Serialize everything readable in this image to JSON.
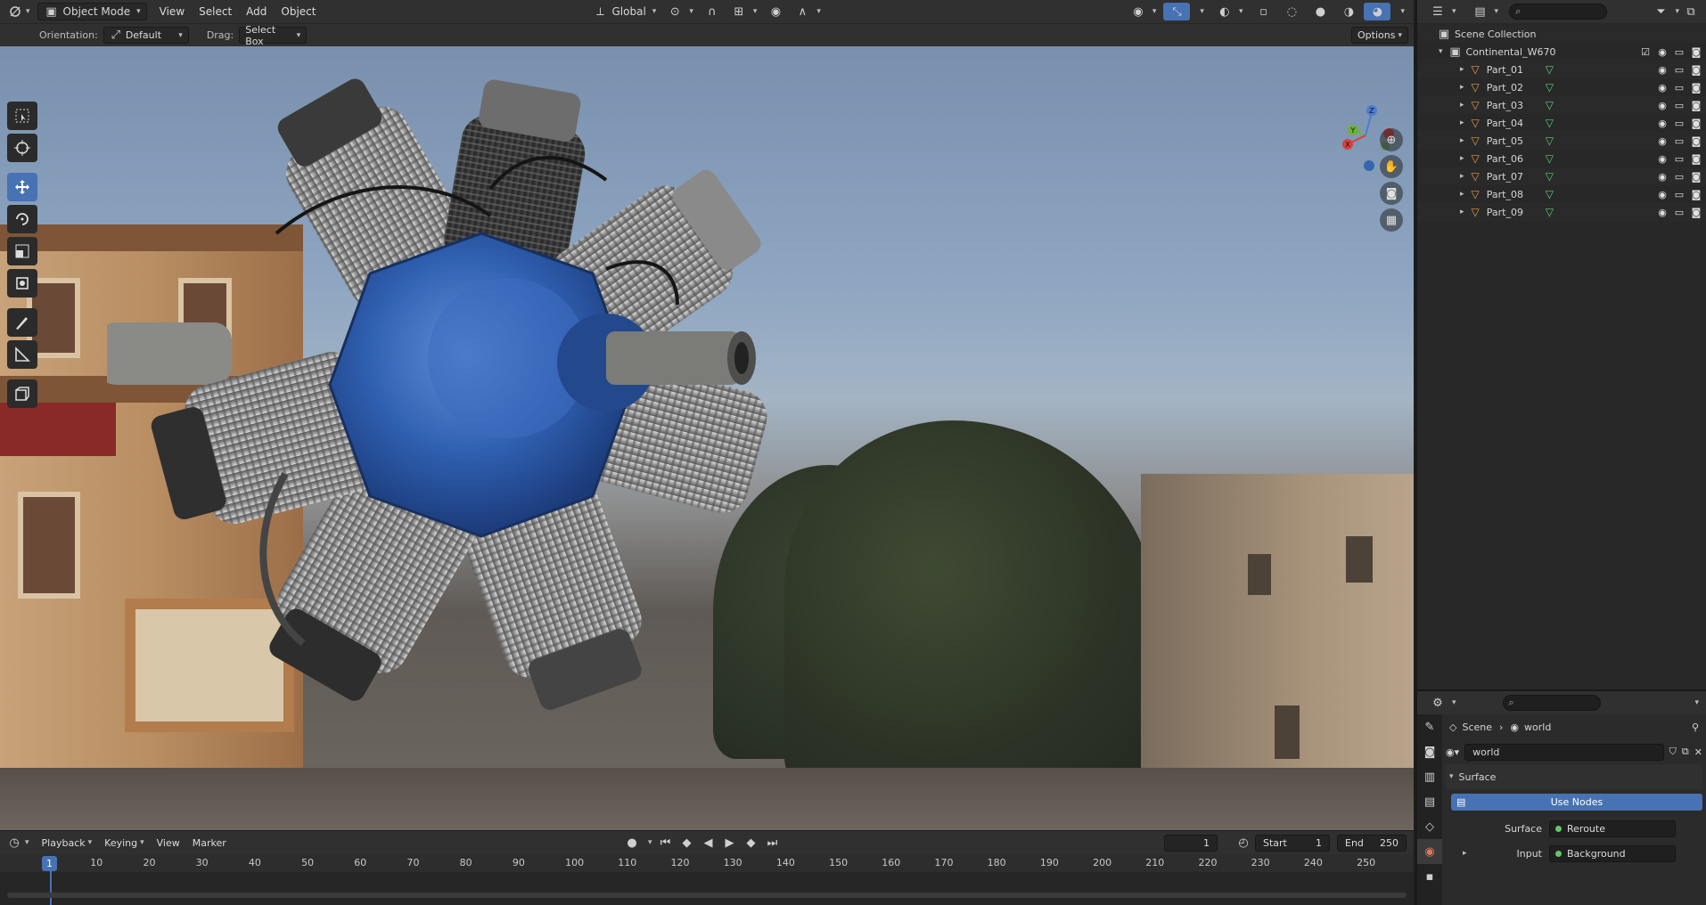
{
  "header": {
    "mode": "Object Mode",
    "menus": [
      "View",
      "Select",
      "Add",
      "Object"
    ],
    "transform_orientation": "Global"
  },
  "tool_header": {
    "orientation_label": "Orientation:",
    "orientation_value": "Default",
    "drag_label": "Drag:",
    "drag_value": "Select Box",
    "options": "Options"
  },
  "gizmo": {
    "x": "X",
    "y": "Y",
    "z": "Z"
  },
  "outliner": {
    "root": "Scene Collection",
    "collection": "Continental_W670",
    "items": [
      {
        "name": "Part_01"
      },
      {
        "name": "Part_02"
      },
      {
        "name": "Part_03"
      },
      {
        "name": "Part_04"
      },
      {
        "name": "Part_05"
      },
      {
        "name": "Part_06"
      },
      {
        "name": "Part_07"
      },
      {
        "name": "Part_08"
      },
      {
        "name": "Part_09"
      }
    ]
  },
  "properties": {
    "breadcrumb_scene": "Scene",
    "breadcrumb_world": "world",
    "world_name": "world",
    "panel_title": "Surface",
    "use_nodes": "Use Nodes",
    "surface_label": "Surface",
    "surface_value": "Reroute",
    "input_label": "Input",
    "input_value": "Background"
  },
  "timeline": {
    "menus": [
      "Playback",
      "Keying",
      "View",
      "Marker"
    ],
    "current_frame": "1",
    "start_label": "Start",
    "start_value": "1",
    "end_label": "End",
    "end_value": "250",
    "ticks": [
      "10",
      "20",
      "30",
      "40",
      "50",
      "60",
      "70",
      "80",
      "90",
      "100",
      "110",
      "120",
      "130",
      "140",
      "150",
      "160",
      "170",
      "180",
      "190",
      "200",
      "210",
      "220",
      "230",
      "240",
      "250"
    ],
    "playhead_frame": "1"
  },
  "colors": {
    "accent": "#4772b3",
    "engine_blue": "#2f5fb0",
    "mesh_orange": "#e69a4b",
    "data_green": "#5fcb7a"
  }
}
